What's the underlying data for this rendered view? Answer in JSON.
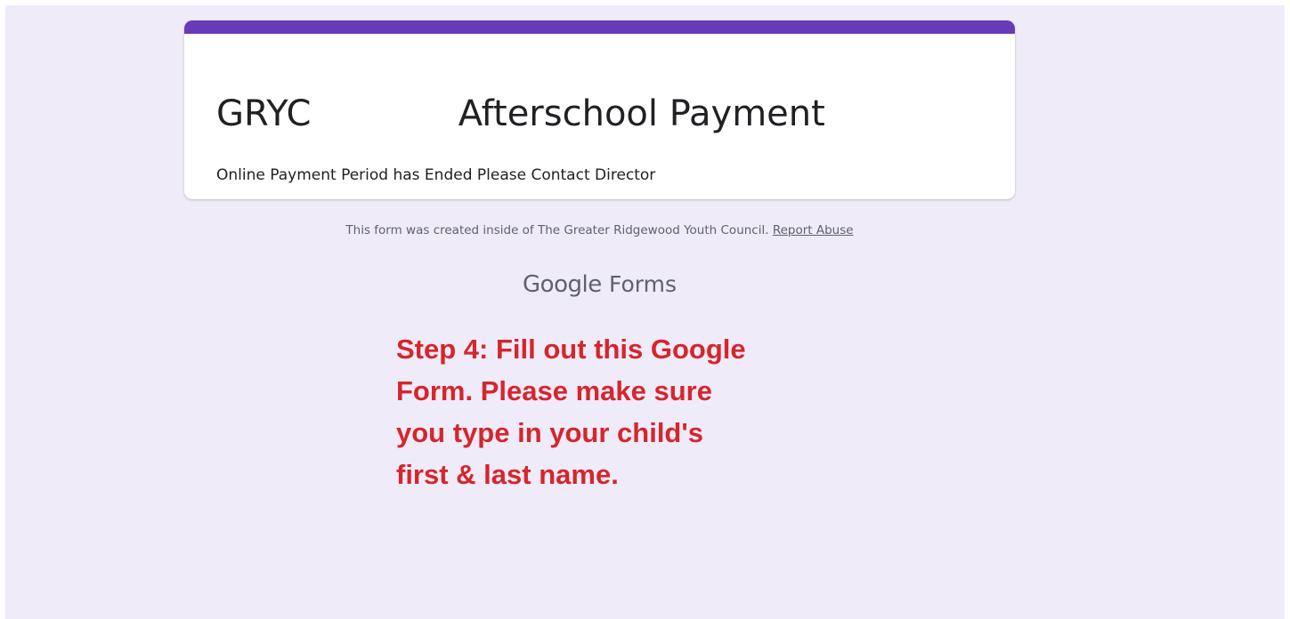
{
  "form": {
    "title": "GRYC             Afterschool Payment",
    "description": "Online Payment Period has Ended Please Contact Director"
  },
  "footer": {
    "created_text": "This form was created inside of The Greater Ridgewood Youth Council.",
    "report_link": "Report Abuse"
  },
  "logo": {
    "google": "Google",
    "forms": "Forms"
  },
  "annotation": {
    "lines": [
      "Step 4: Fill out this Google",
      "Form. Please make sure",
      "you type in your child's",
      "first & last name."
    ]
  },
  "colors": {
    "accent": "#673ab7",
    "background": "#efebf8",
    "annotation_text": "#d6252c"
  }
}
